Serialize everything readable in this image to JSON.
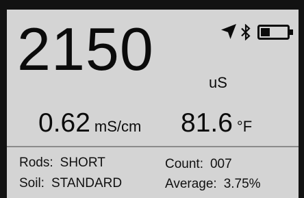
{
  "display": {
    "main_value": "2150",
    "main_unit": "uS",
    "conductivity": {
      "value": "0.62",
      "unit": "mS/cm"
    },
    "temperature": {
      "value": "81.6",
      "unit": "°F"
    }
  },
  "status_icons": [
    "gps-arrow-icon",
    "bluetooth-icon",
    "battery-icon"
  ],
  "battery_level": 0.35,
  "info": {
    "rods_label": "Rods:",
    "rods_value": "SHORT",
    "soil_label": "Soil:",
    "soil_value": "STANDARD",
    "count_label": "Count:",
    "count_value": "007",
    "average_label": "Average:",
    "average_value": "3.75%"
  }
}
